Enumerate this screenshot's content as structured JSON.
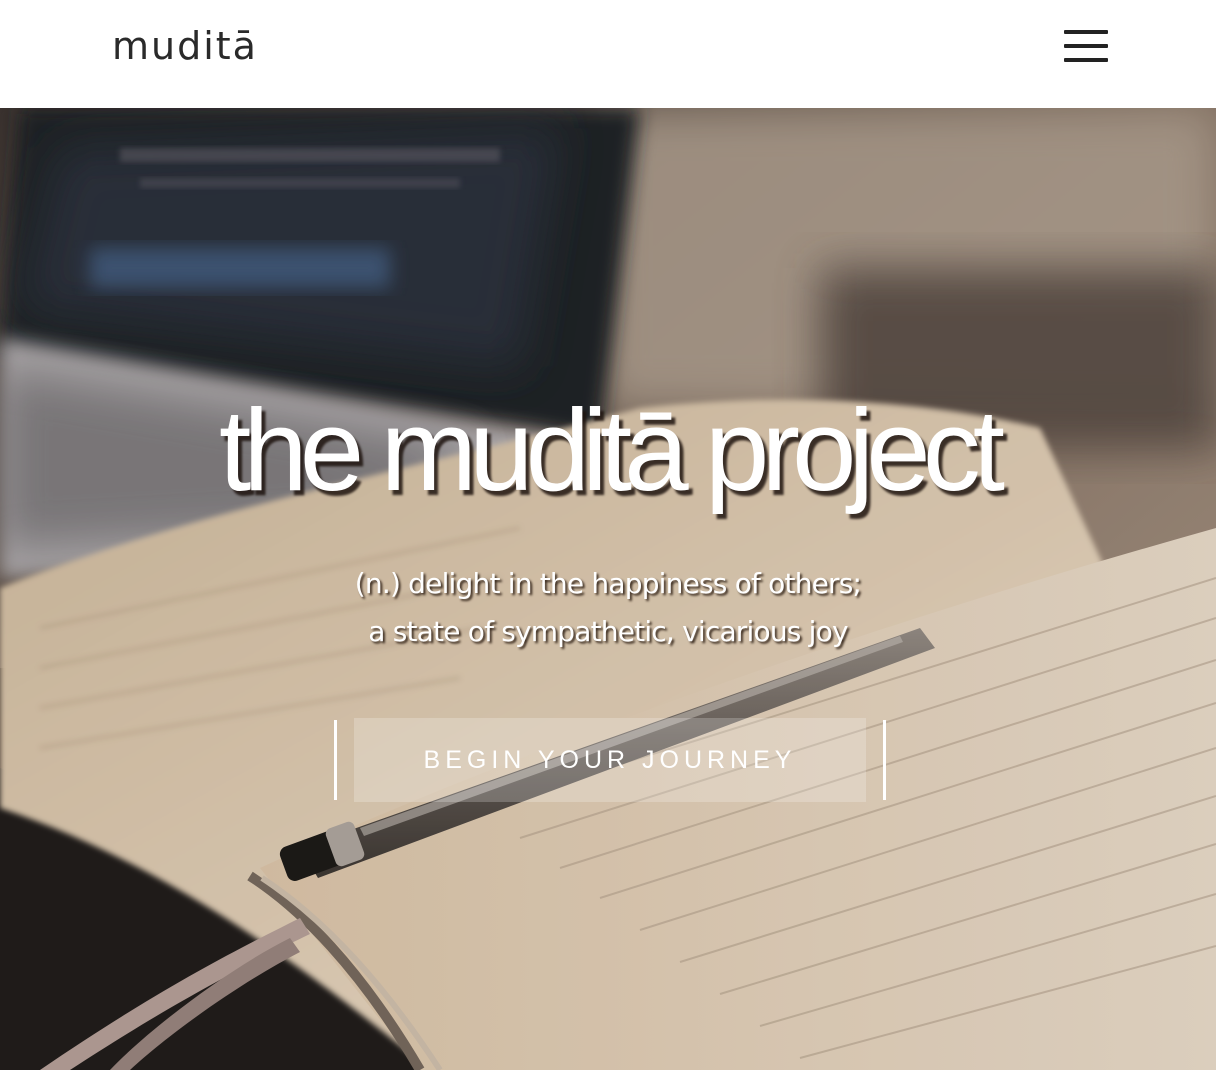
{
  "header": {
    "logo_text": "muditā",
    "menu_icon": "hamburger-menu-icon"
  },
  "hero": {
    "title": "the muditā project",
    "definition_line1": "(n.) delight in the happiness of others;",
    "definition_line2": "a state of sympathetic, vicarious joy",
    "cta_label": "BEGIN YOUR JOURNEY"
  },
  "colors": {
    "header_bg": "#ffffff",
    "logo_text": "#2a2a2a",
    "hero_text": "#ffffff"
  }
}
